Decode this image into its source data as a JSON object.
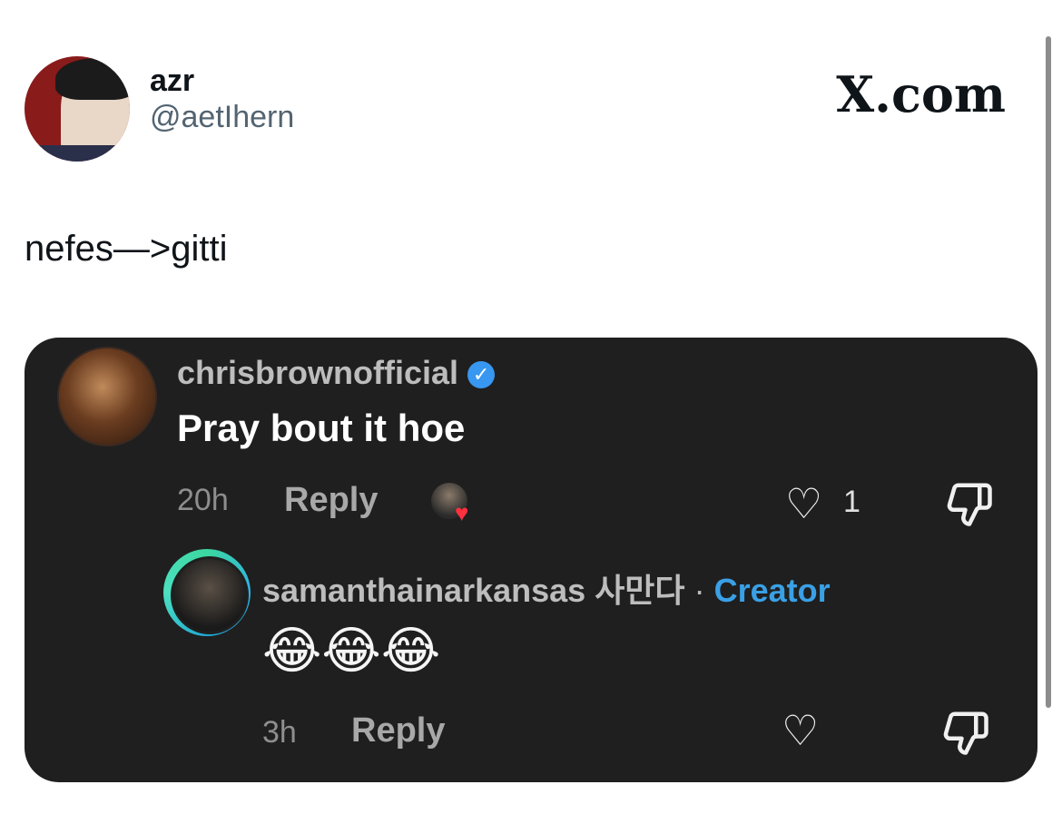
{
  "tweet": {
    "display_name": "azr",
    "handle": "@aetIhern",
    "brand": "X.com",
    "text": "nefes—>gitti"
  },
  "embed": {
    "comment": {
      "username": "chrisbrownofficial",
      "verified_icon": "verified-check-icon",
      "text": "Pray bout it hoe",
      "time": "20h",
      "reply_label": "Reply",
      "like_count": "1"
    },
    "reply": {
      "username": "samanthainarkansas 사만다",
      "separator": "·",
      "role": "Creator",
      "text": "😂😂😂",
      "time": "3h",
      "reply_label": "Reply"
    }
  },
  "colors": {
    "embed_background": "#1f1f1f",
    "creator_accent": "#3aa0e6",
    "heart_red": "#ff3040",
    "verified_blue": "#3897f0"
  }
}
